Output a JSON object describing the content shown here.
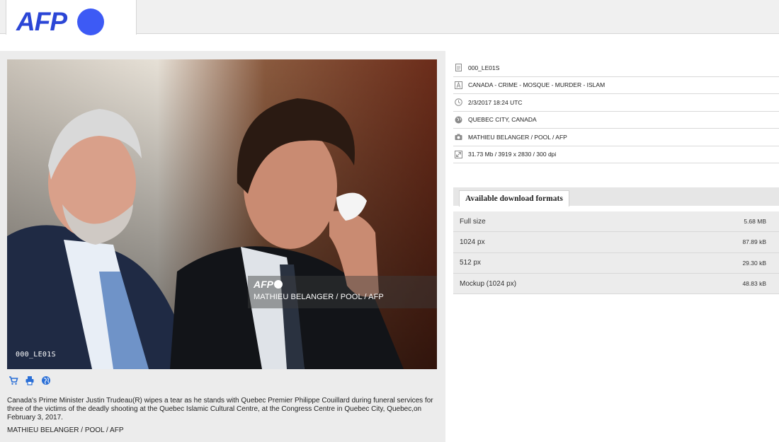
{
  "header": {
    "logo_text": "AFP",
    "accent_color": "#3d5af5"
  },
  "photo": {
    "watermark_logo": "AFP",
    "watermark_credit": "MATHIEU BELANGER / POOL / AFP",
    "photo_id": "000_LE01S"
  },
  "actions": [
    {
      "icon": "cart-icon"
    },
    {
      "icon": "print-icon"
    },
    {
      "icon": "globe-icon"
    }
  ],
  "caption": {
    "text": "Canada's Prime Minister Justin Trudeau(R) wipes a tear as he stands with Quebec Premier Philippe Couillard during funeral services for three of the victims of the deadly shooting at the Quebec Islamic Cultural Centre, at the Congress Centre in Quebec City, Quebec,on February 3, 2017.",
    "credit": "MATHIEU BELANGER / POOL / AFP"
  },
  "info": [
    {
      "icon": "document-icon",
      "text": "000_LE01S"
    },
    {
      "icon": "text-icon",
      "text": "CANADA - CRIME - MOSQUE - MURDER - ISLAM"
    },
    {
      "icon": "clock-icon",
      "text": "2/3/2017 18:24 UTC"
    },
    {
      "icon": "globe-icon",
      "text": "QUEBEC CITY, CANADA"
    },
    {
      "icon": "camera-icon",
      "text": "MATHIEU BELANGER / POOL / AFP"
    },
    {
      "icon": "resize-icon",
      "text": "31.73 Mb / 3919 x 2830 / 300 dpi"
    }
  ],
  "formats": {
    "tab_label": "Available download formats",
    "rows": [
      {
        "label": "Full size",
        "size": "5.68 MB"
      },
      {
        "label": "1024 px",
        "size": "87.89 kB"
      },
      {
        "label": "512 px",
        "size": "29.30 kB"
      },
      {
        "label": "Mockup (1024 px)",
        "size": "48.83 kB"
      }
    ]
  },
  "colors": {
    "link_blue": "#2a6fd6",
    "panel_grey": "#ececec"
  }
}
